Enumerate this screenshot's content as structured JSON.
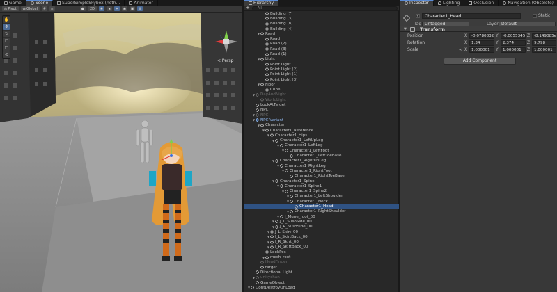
{
  "scene_tabs": [
    {
      "label": "Game",
      "active": false
    },
    {
      "label": "Scene",
      "active": true
    },
    {
      "label": "SuperSimpleSkybox (noth...",
      "active": false
    },
    {
      "label": "Animator",
      "active": false
    }
  ],
  "scene_toolbar": {
    "pivot": "Pivot",
    "space": "Global",
    "view_mode": "2D"
  },
  "viewport": {
    "projection_label": "< Persp"
  },
  "hierarchy": {
    "tab_label": "Hierarchy",
    "add_label": "+",
    "search_placeholder": "All",
    "rows": [
      {
        "label": "Building (7)",
        "depth": 3,
        "arrow": false
      },
      {
        "label": "Building (3)",
        "depth": 3,
        "arrow": false
      },
      {
        "label": "Building (8)",
        "depth": 3,
        "arrow": false
      },
      {
        "label": "Building (4)",
        "depth": 3,
        "arrow": false
      },
      {
        "label": "Road",
        "depth": 2,
        "arrow": true
      },
      {
        "label": "Road",
        "depth": 3,
        "arrow": false
      },
      {
        "label": "Road (2)",
        "depth": 3,
        "arrow": false
      },
      {
        "label": "Road (3)",
        "depth": 3,
        "arrow": false
      },
      {
        "label": "Road (1)",
        "depth": 3,
        "arrow": false
      },
      {
        "label": "Light",
        "depth": 2,
        "arrow": true
      },
      {
        "label": "Point Light",
        "depth": 3,
        "arrow": false
      },
      {
        "label": "Point Light (2)",
        "depth": 3,
        "arrow": false
      },
      {
        "label": "Point Light (1)",
        "depth": 3,
        "arrow": false
      },
      {
        "label": "Point Light (3)",
        "depth": 3,
        "arrow": false
      },
      {
        "label": "Floor",
        "depth": 2,
        "arrow": true
      },
      {
        "label": "Cube",
        "depth": 3,
        "arrow": false
      },
      {
        "label": "DayAndNight",
        "depth": 1,
        "arrow": true,
        "style": "dim"
      },
      {
        "label": "WorldLight",
        "depth": 2,
        "arrow": false,
        "style": "dim"
      },
      {
        "label": "LookAtTarget",
        "depth": 1,
        "arrow": false
      },
      {
        "label": "NPC",
        "depth": 1,
        "arrow": false
      },
      {
        "label": "NPC",
        "depth": 1,
        "arrow": true,
        "style": "dim"
      },
      {
        "label": "NPC Variant",
        "depth": 1,
        "arrow": true
      },
      {
        "label": "Character",
        "depth": 2,
        "arrow": true
      },
      {
        "label": "Character1_Reference",
        "depth": 3,
        "arrow": true
      },
      {
        "label": "Character1_Hips",
        "depth": 4,
        "arrow": true
      },
      {
        "label": "Character1_LeftUpLeg",
        "depth": 5,
        "arrow": true
      },
      {
        "label": "Character1_LeftLeg",
        "depth": 6,
        "arrow": true
      },
      {
        "label": "Character1_LeftFoot",
        "depth": 7,
        "arrow": true
      },
      {
        "label": "Character1_LeftToeBase",
        "depth": 8,
        "arrow": false
      },
      {
        "label": "Character1_RightUpLeg",
        "depth": 5,
        "arrow": true
      },
      {
        "label": "Character1_RightLeg",
        "depth": 6,
        "arrow": true
      },
      {
        "label": "Character1_RightFoot",
        "depth": 7,
        "arrow": true
      },
      {
        "label": "Character1_RightToeBase",
        "depth": 8,
        "arrow": false
      },
      {
        "label": "Character1_Spine",
        "depth": 5,
        "arrow": true
      },
      {
        "label": "Character1_Spine1",
        "depth": 6,
        "arrow": true
      },
      {
        "label": "Character1_Spine2",
        "depth": 7,
        "arrow": true
      },
      {
        "label": "Character1_LeftShoulder",
        "depth": 8,
        "arrow": true
      },
      {
        "label": "Character1_Neck",
        "depth": 8,
        "arrow": true
      },
      {
        "label": "Character1_Head",
        "depth": 9,
        "arrow": false,
        "style": "sel"
      },
      {
        "label": "Character1_RightShoulder",
        "depth": 8,
        "arrow": true
      },
      {
        "label": "J_Mune_root_00",
        "depth": 6,
        "arrow": true
      },
      {
        "label": "J_L_SusoSide_00",
        "depth": 5,
        "arrow": true
      },
      {
        "label": "J_R_SusoSide_00",
        "depth": 5,
        "arrow": true
      },
      {
        "label": "J_L_Skirt_00",
        "depth": 4,
        "arrow": true
      },
      {
        "label": "J_L_SkirtBack_00",
        "depth": 4,
        "arrow": true
      },
      {
        "label": "J_R_Skirt_00",
        "depth": 4,
        "arrow": true
      },
      {
        "label": "J_R_SkirtBack_00",
        "depth": 4,
        "arrow": true
      },
      {
        "label": "LookPos",
        "depth": 3,
        "arrow": false
      },
      {
        "label": "mesh_root",
        "depth": 3,
        "arrow": true
      },
      {
        "label": "HeadFinder",
        "depth": 2,
        "arrow": false,
        "style": "dim"
      },
      {
        "label": "target",
        "depth": 2,
        "arrow": false
      },
      {
        "label": "Directional Light",
        "depth": 1,
        "arrow": false
      },
      {
        "label": "unitychan",
        "depth": 1,
        "arrow": true,
        "style": "dim"
      },
      {
        "label": "GameObject",
        "depth": 1,
        "arrow": false
      },
      {
        "label": "DontDestroyOnLoad",
        "depth": 0,
        "arrow": true
      }
    ]
  },
  "inspector_tabs": [
    {
      "label": "Inspector",
      "active": true
    },
    {
      "label": "Lighting",
      "active": false
    },
    {
      "label": "Occlusion",
      "active": false
    },
    {
      "label": "Navigation (Obsolete)",
      "active": false
    }
  ],
  "inspector": {
    "object_name": "Character1_Head",
    "static_label": "Static",
    "tag_label": "Tag",
    "tag_value": "Untagged",
    "layer_label": "Layer",
    "layer_value": "Default",
    "component_title": "Transform",
    "position_label": "Position",
    "rotation_label": "Rotation",
    "scale_label": "Scale",
    "x_label": "X",
    "y_label": "Y",
    "z_label": "Z",
    "position": {
      "x": "-0.0780832",
      "y": "-0.0055345",
      "z": "-8.149085e-"
    },
    "rotation": {
      "x": "1.34",
      "y": "2.374",
      "z": "9.798"
    },
    "scale": {
      "x": "1.000001",
      "y": "1.000001",
      "z": "1.000001"
    },
    "add_component": "Add Component"
  },
  "colors": {
    "selection": "#2f5283",
    "panel": "#383838",
    "hierarchy_bg": "#282828",
    "prefab_blue": "#8db4ea"
  }
}
